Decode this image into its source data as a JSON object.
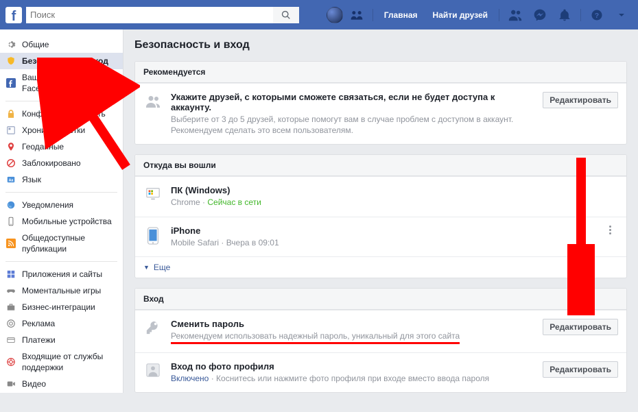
{
  "topbar": {
    "search_placeholder": "Поиск",
    "home": "Главная",
    "find_friends": "Найти друзей"
  },
  "sidebar": {
    "items": [
      {
        "label": "Общие"
      },
      {
        "label": "Безопасность и вход"
      },
      {
        "label": "Ваша информация на Facebook"
      },
      {
        "label": "Конфиденциальность"
      },
      {
        "label": "Хроника и метки"
      },
      {
        "label": "Геоданные"
      },
      {
        "label": "Заблокировано"
      },
      {
        "label": "Язык"
      },
      {
        "label": "Уведомления"
      },
      {
        "label": "Мобильные устройства"
      },
      {
        "label": "Общедоступные публикации"
      },
      {
        "label": "Приложения и сайты"
      },
      {
        "label": "Моментальные игры"
      },
      {
        "label": "Бизнес-интеграции"
      },
      {
        "label": "Реклама"
      },
      {
        "label": "Платежи"
      },
      {
        "label": "Входящие от службы поддержки"
      },
      {
        "label": "Видео"
      }
    ]
  },
  "page_title": "Безопасность и вход",
  "recommend": {
    "heading": "Рекомендуется",
    "title": "Укажите друзей, с которыми сможете связаться, если не будет доступа к аккаунту.",
    "sub": "Выберите от 3 до 5 друзей, которые помогут вам в случае проблем с доступом в аккаунт. Рекомендуем сделать это всем пользователям.",
    "edit": "Редактировать"
  },
  "sessions": {
    "heading": "Откуда вы вошли",
    "items": [
      {
        "title": "ПК (Windows)",
        "browser": "Chrome",
        "sep": " · ",
        "status": "Сейчас в сети"
      },
      {
        "title": "iPhone",
        "browser": "Mobile Safari",
        "sep": " · ",
        "status_plain": "Вчера в 09:01"
      }
    ],
    "more": "Еще"
  },
  "login": {
    "heading": "Вход",
    "change_pw_title": "Сменить пароль",
    "change_pw_sub": "Рекомендуем использовать надежный пароль, уникальный для этого сайта",
    "photo_title": "Вход по фото профиля",
    "photo_status": "Включено",
    "photo_sep": " · ",
    "photo_sub": "Коснитесь или нажмите фото профиля при входе вместо ввода пароля",
    "edit": "Редактировать"
  }
}
